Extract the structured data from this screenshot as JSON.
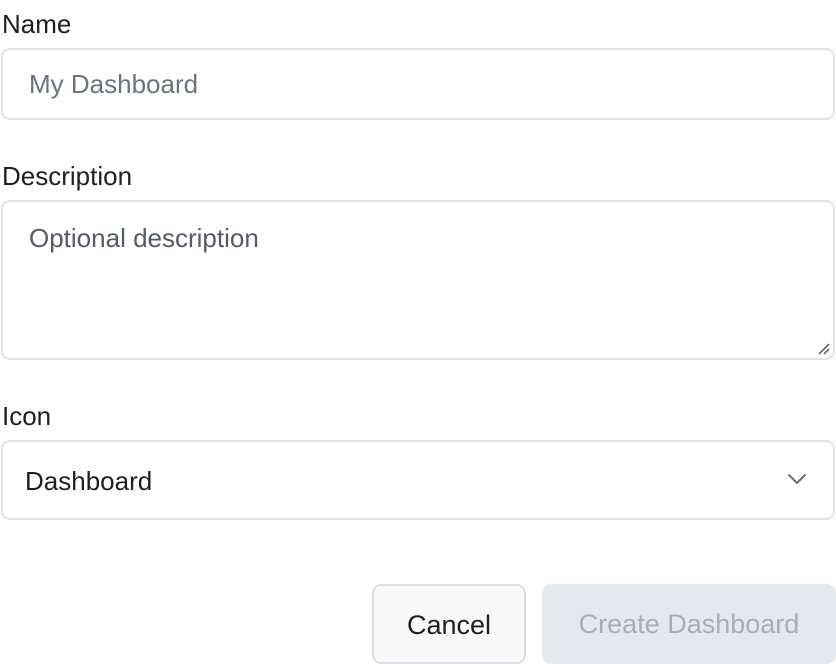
{
  "form": {
    "name": {
      "label": "Name",
      "placeholder": "My Dashboard",
      "value": ""
    },
    "description": {
      "label": "Description",
      "placeholder": "Optional description",
      "value": ""
    },
    "icon": {
      "label": "Icon",
      "selected": "Dashboard",
      "chevron_icon": "chevron-down-icon"
    },
    "actions": {
      "cancel_label": "Cancel",
      "create_label": "Create Dashboard",
      "create_disabled": true
    }
  },
  "colors": {
    "border": "#e2e3e6",
    "placeholder": "#6b7280",
    "text": "#1f1f1f",
    "disabled_button_bg": "#e5e8ef",
    "disabled_button_text": "#a8adb6"
  }
}
